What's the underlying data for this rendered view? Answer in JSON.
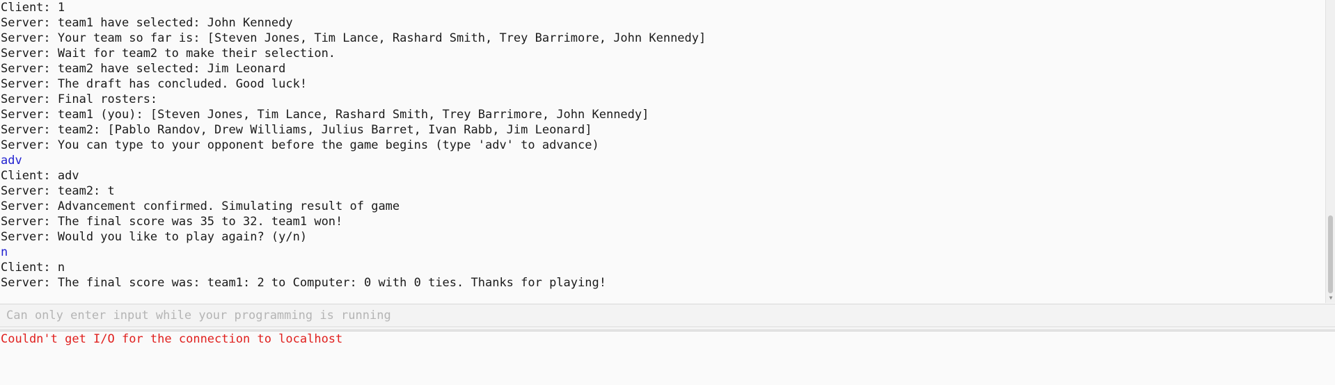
{
  "console": {
    "lines": [
      {
        "text": "Client: 1",
        "kind": "log"
      },
      {
        "text": "Server: team1 have selected: John Kennedy",
        "kind": "log"
      },
      {
        "text": "Server: Your team so far is: [Steven Jones, Tim Lance, Rashard Smith, Trey Barrimore, John Kennedy]",
        "kind": "log"
      },
      {
        "text": "Server: Wait for team2 to make their selection.",
        "kind": "log"
      },
      {
        "text": "Server: team2 have selected: Jim Leonard",
        "kind": "log"
      },
      {
        "text": "Server: The draft has concluded. Good luck!",
        "kind": "log"
      },
      {
        "text": "Server: Final rosters:",
        "kind": "log"
      },
      {
        "text": "Server: team1 (you): [Steven Jones, Tim Lance, Rashard Smith, Trey Barrimore, John Kennedy]",
        "kind": "log"
      },
      {
        "text": "Server: team2: [Pablo Randov, Drew Williams, Julius Barret, Ivan Rabb, Jim Leonard]",
        "kind": "log"
      },
      {
        "text": "Server: You can type to your opponent before the game begins (type 'adv' to advance)",
        "kind": "log"
      },
      {
        "text": "adv",
        "kind": "input"
      },
      {
        "text": "Client: adv",
        "kind": "log"
      },
      {
        "text": "Server: team2: t",
        "kind": "log"
      },
      {
        "text": "Server: Advancement confirmed. Simulating result of game",
        "kind": "log"
      },
      {
        "text": "Server: The final score was 35 to 32. team1 won!",
        "kind": "log"
      },
      {
        "text": "Server: Would you like to play again? (y/n)",
        "kind": "log"
      },
      {
        "text": "n",
        "kind": "input"
      },
      {
        "text": "Client: n",
        "kind": "log"
      },
      {
        "text": "Server: The final score was: team1: 2 to Computer: 0 with 0 ties. Thanks for playing!",
        "kind": "log"
      }
    ]
  },
  "input": {
    "placeholder": "Can only enter input while your programming is running",
    "value": ""
  },
  "errors": {
    "message": "Couldn't get I/O for the connection to localhost"
  },
  "colors": {
    "input_echo": "#1f1fd0",
    "error": "#e0201e",
    "text": "#1a1a1a"
  },
  "icons": {
    "scroll_down": "chevron-down-icon"
  }
}
